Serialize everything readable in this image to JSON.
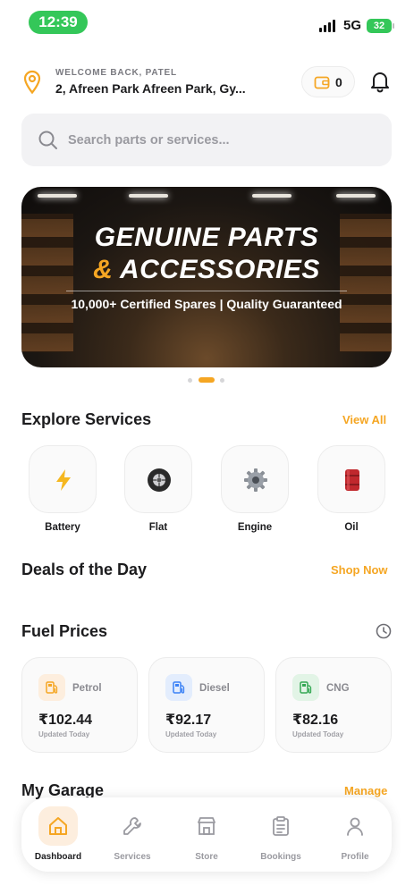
{
  "status_bar": {
    "time": "12:39",
    "network": "5G",
    "battery": "32"
  },
  "header": {
    "welcome": "WELCOME BACK, PATEL",
    "address": "2, Afreen Park Afreen Park, Gy...",
    "wallet_count": "0"
  },
  "search": {
    "placeholder": "Search parts or services..."
  },
  "banner": {
    "line1": "GENUINE PARTS",
    "line2_amp": "&",
    "line2_rest": " ACCESSORIES",
    "subtitle": "10,000+ Certified Spares | Quality Guaranteed",
    "slide_count": 3,
    "active_slide": 2
  },
  "explore": {
    "title": "Explore Services",
    "link": "View All",
    "items": [
      {
        "label": "Battery",
        "icon": "lightning-icon"
      },
      {
        "label": "Flat",
        "icon": "tire-icon"
      },
      {
        "label": "Engine",
        "icon": "gear-icon"
      },
      {
        "label": "Oil",
        "icon": "oil-barrel-icon"
      }
    ]
  },
  "deals": {
    "title": "Deals of the Day",
    "link": "Shop Now"
  },
  "fuel": {
    "title": "Fuel Prices",
    "cards": [
      {
        "name": "Petrol",
        "price": "₹102.44",
        "updated": "Updated Today",
        "color": "#f5a623"
      },
      {
        "name": "Diesel",
        "price": "₹92.17",
        "updated": "Updated Today",
        "color": "#3b82f6"
      },
      {
        "name": "CNG",
        "price": "₹82.16",
        "updated": "Updated Today",
        "color": "#34a853"
      }
    ]
  },
  "garage": {
    "title": "My Garage",
    "link": "Manage"
  },
  "nav": {
    "items": [
      {
        "label": "Dashboard",
        "icon": "home-icon",
        "active": true
      },
      {
        "label": "Services",
        "icon": "wrench-icon",
        "active": false
      },
      {
        "label": "Store",
        "icon": "store-icon",
        "active": false
      },
      {
        "label": "Bookings",
        "icon": "clipboard-icon",
        "active": false
      },
      {
        "label": "Profile",
        "icon": "user-icon",
        "active": false
      }
    ]
  },
  "colors": {
    "accent": "#f5a623",
    "status_green": "#34c759",
    "text": "#1c1c1e"
  }
}
